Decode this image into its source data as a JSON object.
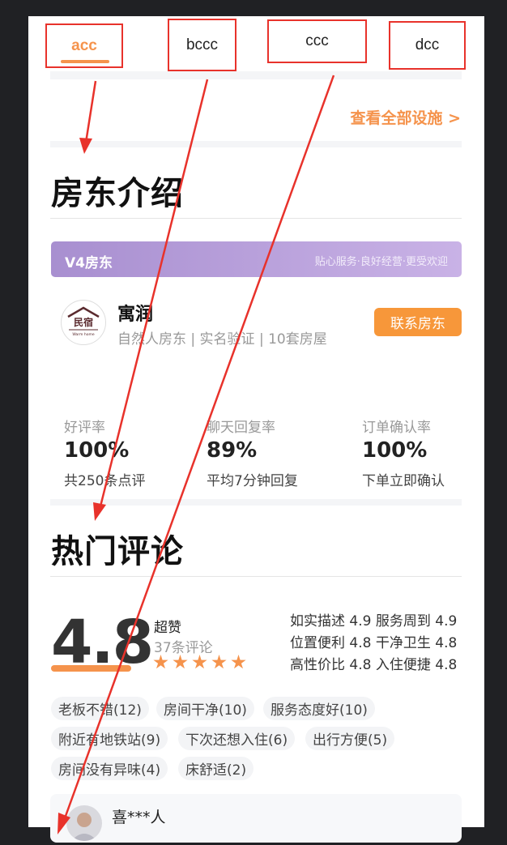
{
  "tabs": [
    {
      "label": "acc",
      "active": true
    },
    {
      "label": "bccc",
      "active": false
    },
    {
      "label": "ccc",
      "active": false
    },
    {
      "label": "dcc",
      "active": false
    }
  ],
  "facilities": {
    "see_all_label": "查看全部设施 >"
  },
  "host_section": {
    "title": "房东介绍",
    "level_name": "V4房东",
    "level_slogan": "贴心服务·良好经营·更受欢迎",
    "avatar_logo_text": "民宿",
    "avatar_logo_subtext": "Warm home",
    "host_name": "寓润",
    "host_info": "自然人房东 | 实名验证 | 10套房屋",
    "contact_button": "联系房东",
    "stats": [
      {
        "label": "好评率",
        "value": "100%",
        "note": "共250条点评"
      },
      {
        "label": "聊天回复率",
        "value": "89%",
        "note": "平均7分钟回复"
      },
      {
        "label": "订单确认率",
        "value": "100%",
        "note": "下单立即确认"
      }
    ]
  },
  "reviews_section": {
    "title": "热门评论",
    "score": "4.8",
    "score_level": "超赞",
    "review_count": "37条评论",
    "star_count": 5,
    "sub_scores": [
      "如实描述 4.9 服务周到 4.9",
      "位置便利 4.8 干净卫生 4.8",
      "高性价比 4.8 入住便捷 4.8"
    ],
    "tags": [
      "老板不错(12)",
      "房间干净(10)",
      "服务态度好(10)",
      "附近有地铁站(9)",
      "下次还想入住(6)",
      "出行方便(5)",
      "房间没有异味(4)",
      "床舒适(2)"
    ],
    "first_review": {
      "user_name": "喜***人"
    }
  },
  "colors": {
    "accent": "#f5934c",
    "annotation_red": "#e8322b",
    "level_bar_start": "#a88fd0",
    "level_bar_end": "#c9b2e6",
    "contact_button": "#f7973a"
  }
}
